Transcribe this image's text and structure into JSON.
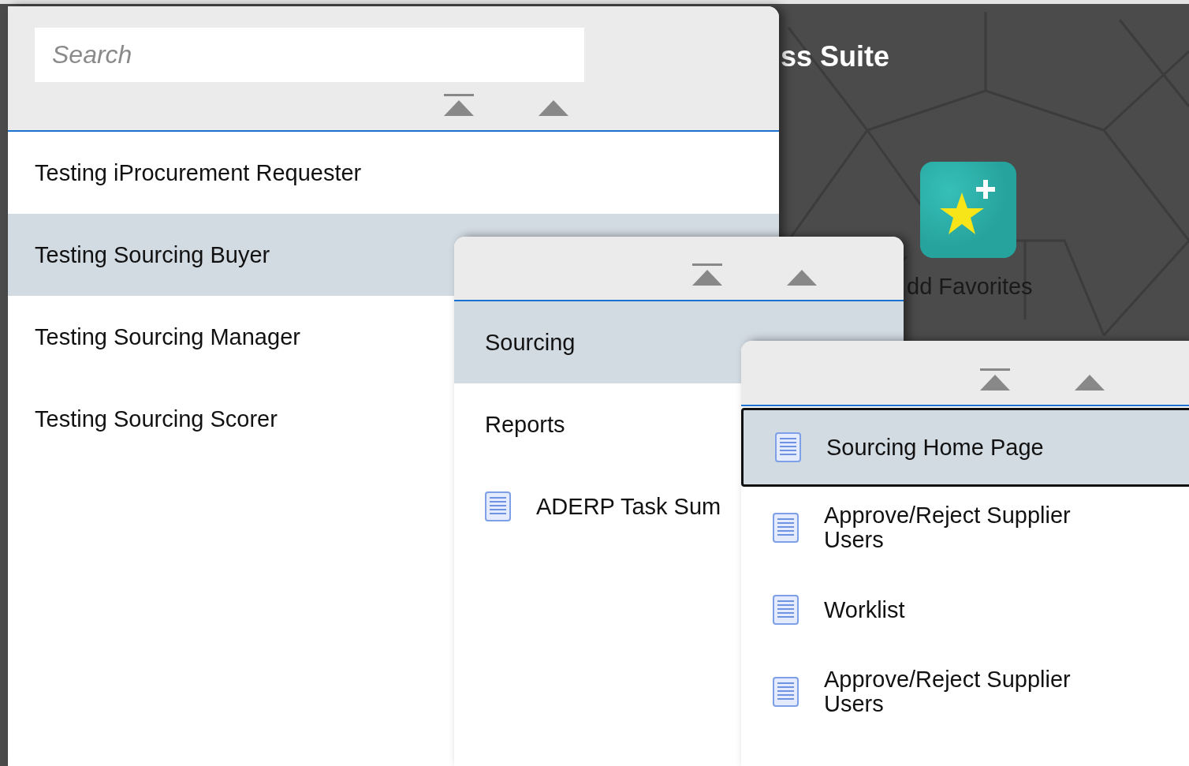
{
  "background": {
    "title": "ss Suite",
    "tile": {
      "label": "dd Favorites"
    }
  },
  "panels": [
    {
      "search": {
        "placeholder": "Search"
      },
      "items": [
        {
          "kind": "folder",
          "label": "Testing iProcurement Requester",
          "selected": false,
          "focused": false
        },
        {
          "kind": "folder",
          "label": "Testing Sourcing Buyer",
          "selected": true,
          "focused": false
        },
        {
          "kind": "folder",
          "label": "Testing Sourcing Manager",
          "selected": false,
          "focused": false
        },
        {
          "kind": "folder",
          "label": "Testing Sourcing Scorer",
          "selected": false,
          "focused": false
        }
      ]
    },
    {
      "items": [
        {
          "kind": "folder",
          "label": "Sourcing",
          "selected": true,
          "focused": false
        },
        {
          "kind": "folder",
          "label": "Reports",
          "selected": false,
          "focused": false
        },
        {
          "kind": "page",
          "label": "ADERP Task Sum",
          "selected": false,
          "focused": false
        }
      ]
    },
    {
      "items": [
        {
          "kind": "page",
          "label": "Sourcing Home Page",
          "selected": true,
          "focused": true
        },
        {
          "kind": "page",
          "label": "Approve/Reject Supplier Users",
          "selected": false,
          "focused": false
        },
        {
          "kind": "page",
          "label": "Worklist",
          "selected": false,
          "focused": false
        },
        {
          "kind": "page",
          "label": "Approve/Reject Supplier Users",
          "selected": false,
          "focused": false
        }
      ]
    }
  ]
}
